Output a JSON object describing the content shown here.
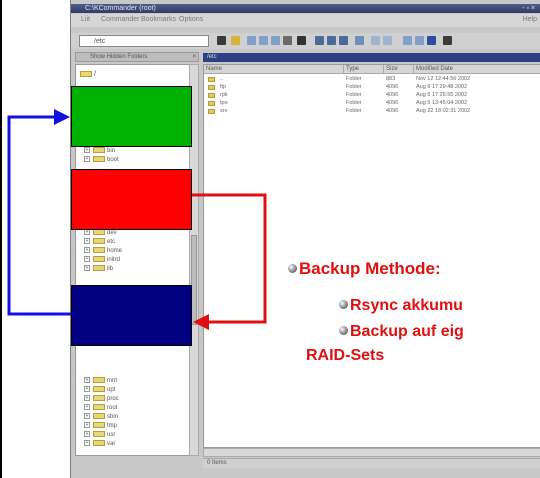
{
  "window": {
    "title": "C:\\KCommander (root)",
    "title_buttons": "- ▫ ×"
  },
  "menu": {
    "items": [
      "Liit",
      "Commander",
      "Bookmarks",
      "Options"
    ],
    "help": "Help"
  },
  "toolbar": {
    "path_value": "/etc"
  },
  "tree": {
    "header_label": "Show Hidden Folders",
    "close_label": "×",
    "root_label": "/",
    "rows": [
      "bin",
      "boot",
      "dev",
      "etc",
      "home",
      "initrd",
      "lib",
      "mnt",
      "opt",
      "proc",
      "root",
      "sbin",
      "tmp",
      "usr",
      "var"
    ]
  },
  "pathbar": {
    "label": "/etc"
  },
  "files": {
    "columns": [
      "Name",
      "Type",
      "Size",
      "Modified Date"
    ],
    "rows": [
      {
        "name": "..",
        "type": "Folder",
        "size": "883",
        "date": "Nov 12 12:44:56 2002"
      },
      {
        "name": "ftp",
        "type": "Folder",
        "size": "4096",
        "date": "Aug 6 17:29:48 2002"
      },
      {
        "name": "rpk",
        "type": "Folder",
        "size": "4096",
        "date": "Aug 6 17:26:55 2002"
      },
      {
        "name": "tpo",
        "type": "Folder",
        "size": "4096",
        "date": "Aug 5 13:45:04 2002"
      },
      {
        "name": "srv",
        "type": "Folder",
        "size": "4096",
        "date": "Aug 22 18:02:31 2002"
      }
    ]
  },
  "status": {
    "text": "0 Items"
  },
  "slide": {
    "line1": "Backup Methode:",
    "line2": "Rsync akkumu",
    "line3": "Backup auf eig",
    "line4": "RAID-Sets"
  },
  "colors": {
    "green_box": "#00b200",
    "red_box": "#ff0000",
    "navy_box": "#000080",
    "blue_arrow": "#1010e0",
    "red_arrow": "#e01010",
    "slide_text": "#e01010"
  }
}
